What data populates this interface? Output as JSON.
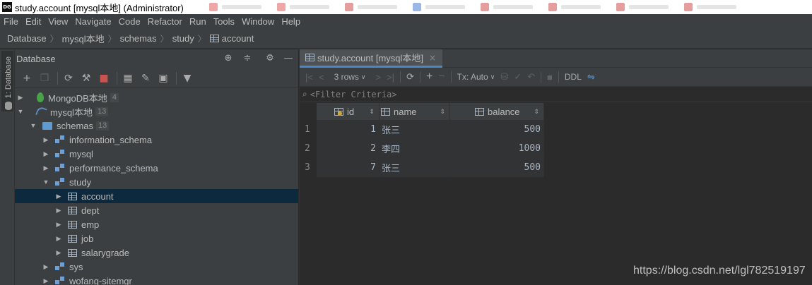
{
  "window": {
    "title": "study.account [mysql本地] (Administrator)",
    "app_icon_text": "DG"
  },
  "menu": [
    "File",
    "Edit",
    "View",
    "Navigate",
    "Code",
    "Refactor",
    "Run",
    "Tools",
    "Window",
    "Help"
  ],
  "breadcrumb": [
    "Database",
    "mysql本地",
    "schemas",
    "study",
    "account"
  ],
  "left_strip": {
    "tab_label": "1: Database"
  },
  "db_panel": {
    "title": "Database",
    "tree": [
      {
        "label": "MongoDB本地",
        "count": "4",
        "icon": "mongodb-leaf-icon",
        "expanded": false
      },
      {
        "label": "mysql本地",
        "count": "13",
        "icon": "mysql-dolphin-icon",
        "expanded": true
      },
      {
        "label": "schemas",
        "count": "13",
        "icon": "folder-icon",
        "expanded": true
      },
      {
        "label": "information_schema",
        "icon": "schema-icon",
        "expanded": false
      },
      {
        "label": "mysql",
        "icon": "schema-icon",
        "expanded": false
      },
      {
        "label": "performance_schema",
        "icon": "schema-icon",
        "expanded": false
      },
      {
        "label": "study",
        "icon": "schema-icon",
        "expanded": true
      },
      {
        "label": "account",
        "icon": "table-icon",
        "expanded": false,
        "selected": true
      },
      {
        "label": "dept",
        "icon": "table-icon",
        "expanded": false
      },
      {
        "label": "emp",
        "icon": "table-icon",
        "expanded": false
      },
      {
        "label": "job",
        "icon": "table-icon",
        "expanded": false
      },
      {
        "label": "salarygrade",
        "icon": "table-icon",
        "expanded": false
      },
      {
        "label": "sys",
        "icon": "schema-icon",
        "expanded": false
      },
      {
        "label": "wofang-sitemgr",
        "icon": "schema-icon",
        "expanded": false
      }
    ]
  },
  "editor": {
    "tab_label": "study.account [mysql本地]",
    "rows_label": "3 rows",
    "tx_label": "Tx: Auto",
    "ddl_label": "DDL",
    "filter_placeholder": "<Filter Criteria>",
    "columns": [
      "id",
      "name",
      "balance"
    ],
    "rows": [
      {
        "num": "1",
        "id": "1",
        "name": "张三",
        "balance": "500"
      },
      {
        "num": "2",
        "id": "2",
        "name": "李四",
        "balance": "1000"
      },
      {
        "num": "3",
        "id": "7",
        "name": "张三",
        "balance": "500"
      }
    ]
  },
  "watermark": "https://blog.csdn.net/lgl782519197"
}
